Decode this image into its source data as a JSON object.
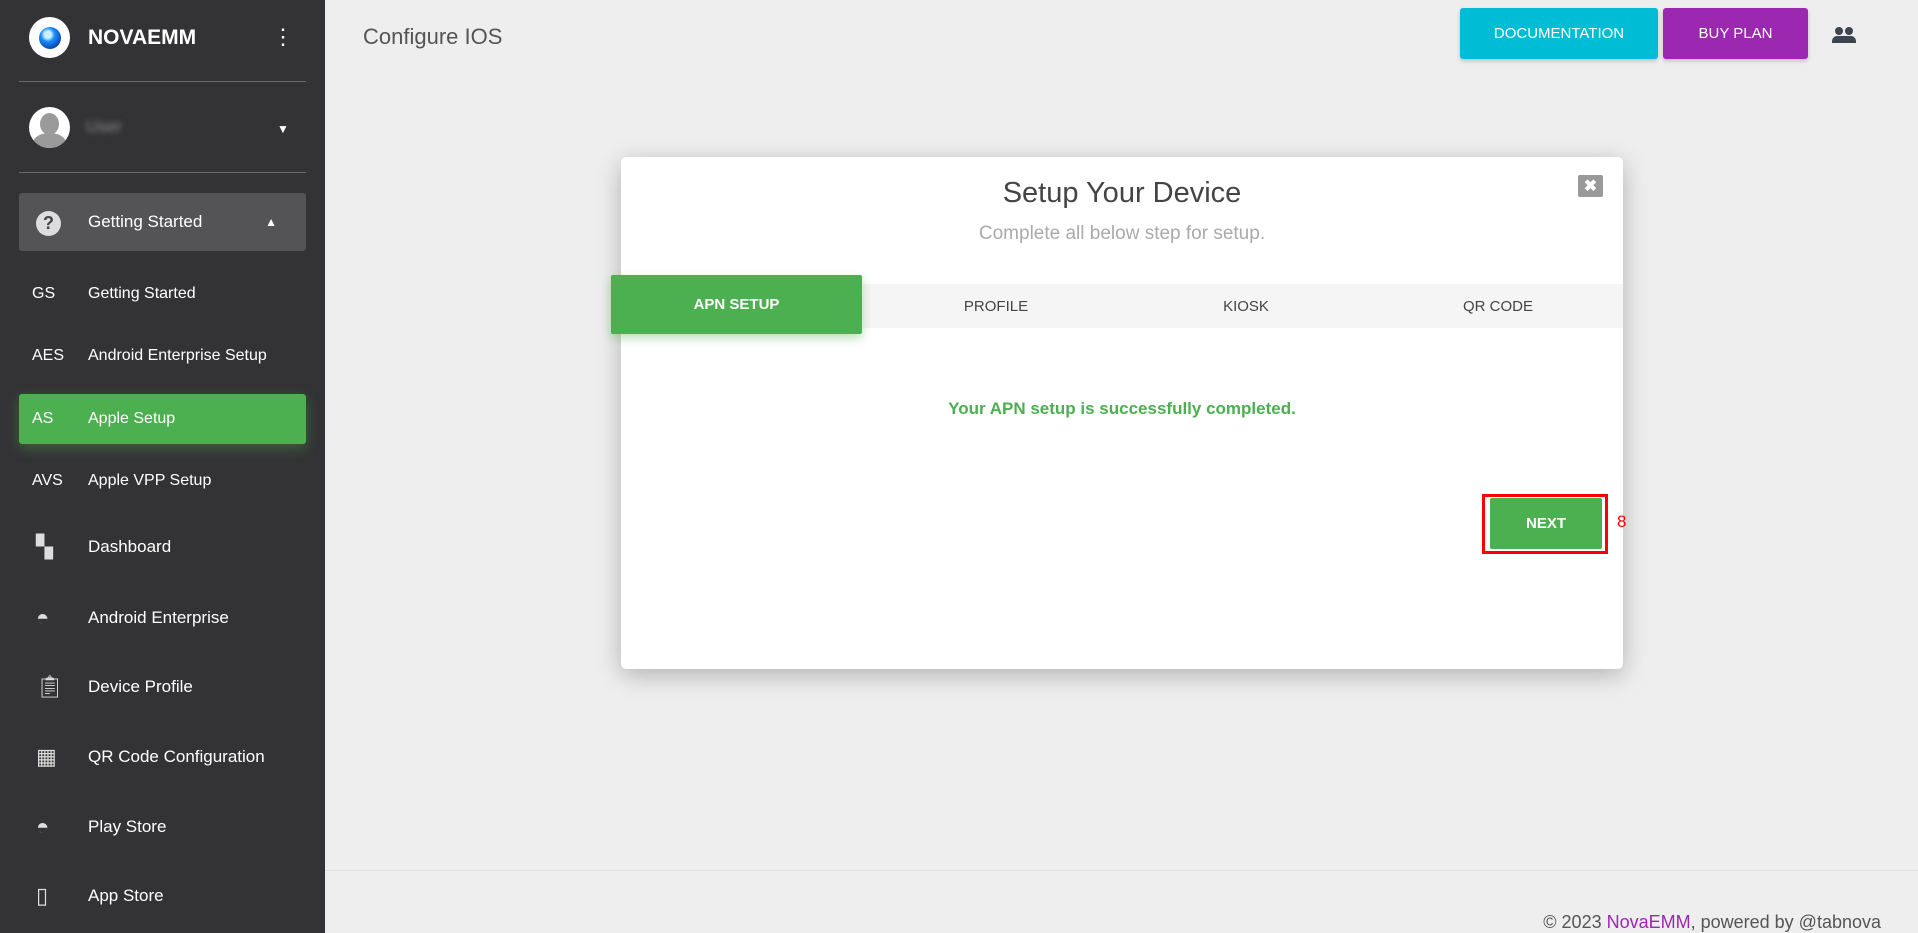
{
  "sidebar": {
    "brand": "NOVAEMM",
    "user_name": "User",
    "group": {
      "label": "Getting Started",
      "icon": "help-circle-icon"
    },
    "subitems": [
      {
        "abbr": "GS",
        "label": "Getting Started"
      },
      {
        "abbr": "AES",
        "label": "Android Enterprise Setup"
      },
      {
        "abbr": "AS",
        "label": "Apple Setup",
        "active": true
      },
      {
        "abbr": "AVS",
        "label": "Apple VPP Setup"
      }
    ],
    "items": [
      {
        "label": "Dashboard",
        "icon": "dashboard-icon"
      },
      {
        "label": "Android Enterprise",
        "icon": "android-icon"
      },
      {
        "label": "Device Profile",
        "icon": "clipboard-icon"
      },
      {
        "label": "QR Code Configuration",
        "icon": "qr-code-icon"
      },
      {
        "label": "Play Store",
        "icon": "android-icon"
      },
      {
        "label": "App Store",
        "icon": "phone-icon"
      }
    ]
  },
  "header": {
    "title": "Configure IOS",
    "documentation": "DOCUMENTATION",
    "buy_plan": "BUY PLAN"
  },
  "colors": {
    "accent": "#4caf50",
    "documentation": "#00bcd4",
    "buy_plan": "#9c27b0",
    "sidebar": "#333335"
  },
  "modal": {
    "title": "Setup Your Device",
    "subtitle": "Complete all below step for setup.",
    "tabs": [
      "APN SETUP",
      "PROFILE",
      "KIOSK",
      "QR CODE"
    ],
    "active_tab": "APN SETUP",
    "message": "Your APN setup is successfully completed.",
    "next": "NEXT"
  },
  "annotation": {
    "label": "8"
  },
  "footer": {
    "prefix": "© 2023 ",
    "brand": "NovaEMM",
    "suffix": ", powered by @tabnova"
  }
}
